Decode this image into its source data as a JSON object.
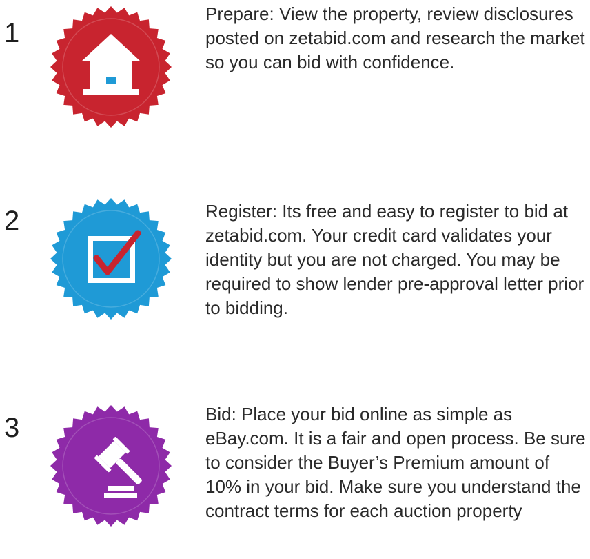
{
  "colors": {
    "step1_badge": "#c8242f",
    "step2_badge": "#1f9ad6",
    "step3_badge": "#8e2aa8",
    "icon_fill": "#ffffff",
    "house_window": "#1f9ad6",
    "checkmark": "#c8242f"
  },
  "steps": [
    {
      "number": "1",
      "icon": "house-icon",
      "text": "Prepare: View the property, review disclosures posted on zetabid.com and research the market so you can bid with confidence."
    },
    {
      "number": "2",
      "icon": "checkbox-icon",
      "text": "Register: Its free and easy to register to bid at zetabid.com. Your credit card validates your identity but you are not charged. You may be required to show lender pre-approval letter prior to bidding."
    },
    {
      "number": "3",
      "icon": "gavel-icon",
      "text": "Bid: Place your bid online as simple as eBay.com. It is a fair and open process. Be sure to consider the Buyer’s Premium amount of 10% in your bid. Make sure you understand the contract terms for each auction property"
    }
  ]
}
